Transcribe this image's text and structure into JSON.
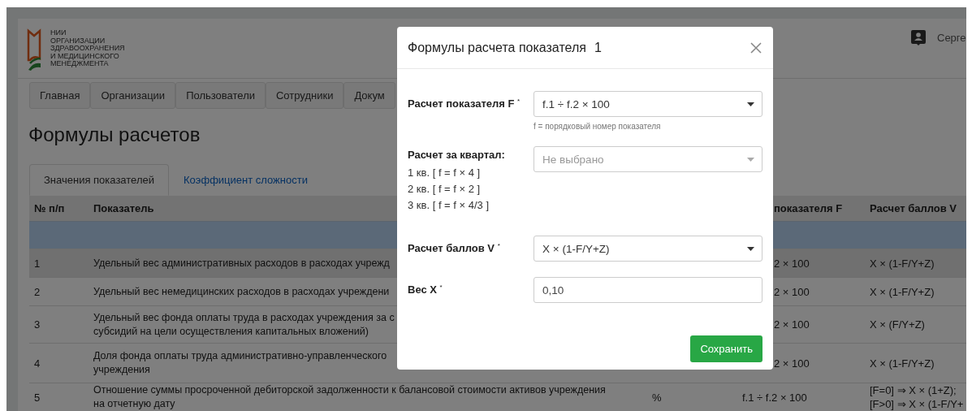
{
  "header": {
    "logo_lines": [
      "НИИ",
      "ОРГАНИЗАЦИИ",
      "ЗДРАВООХРАНЕНИЯ",
      "И МЕДИЦИНСКОГО",
      "МЕНЕДЖМЕНТА"
    ],
    "user": "Серге"
  },
  "nav": [
    {
      "label": "Главная"
    },
    {
      "label": "Организации"
    },
    {
      "label": "Пользователи"
    },
    {
      "label": "Сотрудники"
    },
    {
      "label": "Докум"
    }
  ],
  "page_title": "Формулы расчетов",
  "tabs": [
    {
      "label": "Значения показателей",
      "selected": true
    },
    {
      "label": "Коэффициент сложности",
      "selected": false
    }
  ],
  "table": {
    "columns": [
      "№ п/п",
      "Показатель",
      "",
      "показателя F",
      "Расчет баллов V"
    ],
    "rows": [
      {
        "kind": "group",
        "selected": false,
        "cells": [
          [],
          [],
          [],
          [],
          []
        ]
      },
      {
        "kind": "item",
        "selected": true,
        "cells": [
          [
            "1"
          ],
          [
            "Удельный вес административных расходов в расходах учрежд"
          ],
          [],
          [
            "2 × 100"
          ],
          [
            "X × (1-F/Y+Z)"
          ]
        ]
      },
      {
        "kind": "item",
        "selected": false,
        "cells": [
          [
            "2"
          ],
          [
            "Удельный вес немедицинских расходов в расходах учреждени"
          ],
          [],
          [
            "2 × 100"
          ],
          [
            "X × (1-F/Y+Z)"
          ]
        ]
      },
      {
        "kind": "item",
        "selected": false,
        "cells": [
          [
            "3"
          ],
          [
            "Удельный вес фонда оплаты труда в расходах учреждения за с",
            "субсидий на цели осуществления капитальных вложений)"
          ],
          [],
          [
            "2 × 100"
          ],
          [
            "X × (F/Y+Z)"
          ]
        ]
      },
      {
        "kind": "item",
        "selected": false,
        "cells": [
          [
            "4"
          ],
          [
            "Доля фонда оплаты труда административно-управленческого",
            "учреждения"
          ],
          [],
          [
            "2 × 100"
          ],
          [
            "X × (1-F/Y+Z)"
          ]
        ]
      },
      {
        "kind": "item",
        "selected": false,
        "cells": [
          [
            "5"
          ],
          [
            "Отношение суммы просроченной дебиторской задолженности к балансовой стоимости активов учреждения",
            "на отчетную дату"
          ],
          [
            "%"
          ],
          [
            "f.1 ÷ f.2 × 100"
          ],
          [
            "[F=0] ⇒ X × (1+Z);",
            "[F>0] ⇒ X × (1-F/Y+"
          ]
        ]
      }
    ]
  },
  "modal": {
    "title": "Формулы расчета показателя",
    "number": "1",
    "fields": [
      {
        "kind": "select",
        "label": "Расчет показателя F $^{*}$",
        "value": "f.1 ÷ f.2 × 100",
        "hint": "f = порядковый номер показателя"
      },
      {
        "kind": "select",
        "label": "Расчет за квартал:",
        "notes": [
          "1 кв. [ f = f × 4 ]",
          "2 кв. [ f = f × 2 ]",
          "3 кв. [ f = f × 4/3 ]"
        ],
        "placeholder": "Не выбрано"
      },
      {
        "kind": "select",
        "label": "Расчет баллов V $^{*}$",
        "value": "X × (1-F/Y+Z)"
      },
      {
        "kind": "input",
        "label": "Вес X $^{*}$",
        "value": "0,10"
      }
    ],
    "save_button": "Сохранить"
  }
}
